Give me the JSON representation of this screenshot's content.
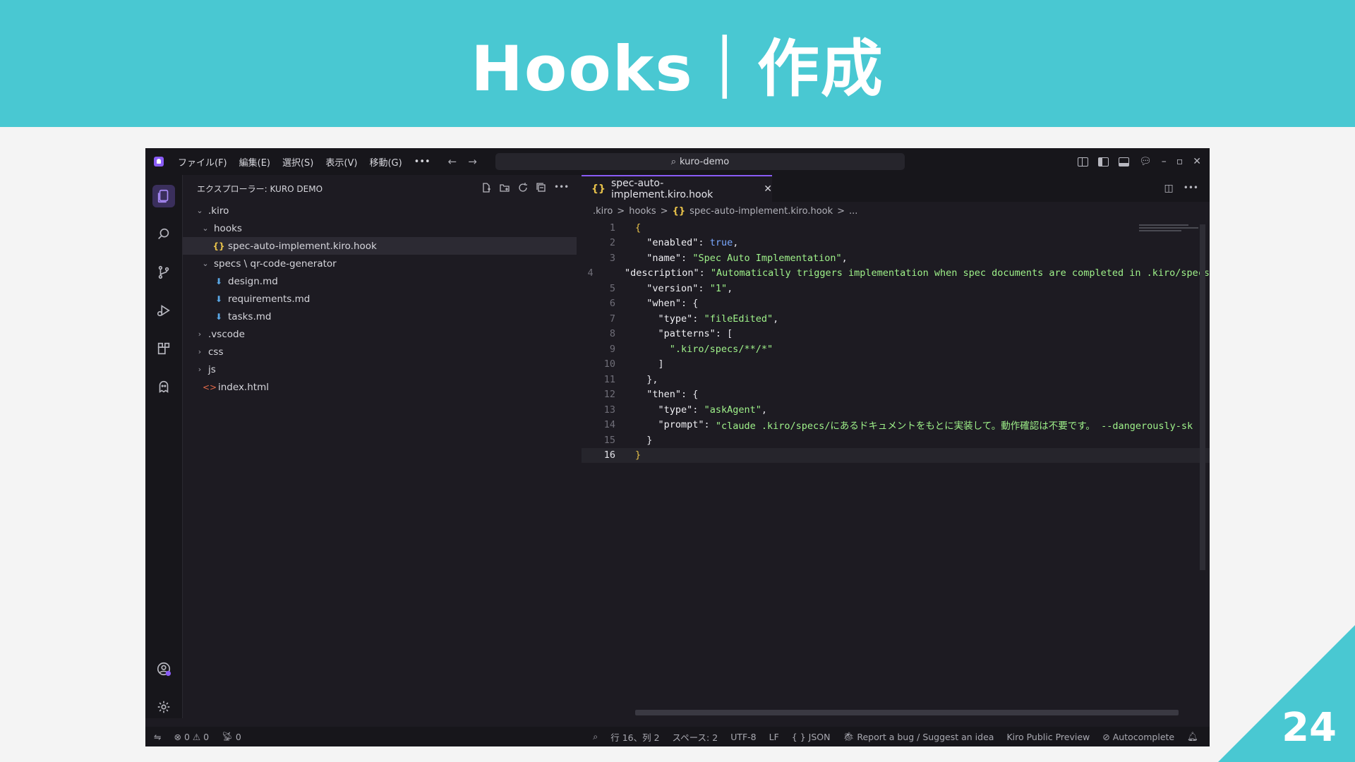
{
  "slide": {
    "title": "Hooks｜作成",
    "page_number": "24"
  },
  "colors": {
    "accent": "#49c8d2",
    "purple": "#8a5cf6"
  },
  "titlebar": {
    "menus": [
      "ファイル(F)",
      "編集(E)",
      "選択(S)",
      "表示(V)",
      "移動(G)"
    ],
    "more": "•••",
    "search": "kuro-demo"
  },
  "sidebar": {
    "header": "エクスプローラー: KURO DEMO",
    "tree": [
      {
        "label": ".kiro",
        "chevron": "⌄",
        "icon": "",
        "indent": 16,
        "selected": false
      },
      {
        "label": "hooks",
        "chevron": "⌄",
        "icon": "",
        "indent": 24,
        "selected": false
      },
      {
        "label": "spec-auto-implement.kiro.hook",
        "chevron": "",
        "icon": "{}",
        "icon_type": "hook",
        "indent": 26,
        "selected": true
      },
      {
        "label": "specs \\ qr-code-generator",
        "chevron": "⌄",
        "icon": "",
        "indent": 24,
        "selected": false
      },
      {
        "label": "design.md",
        "chevron": "",
        "icon": "⬇",
        "icon_type": "md",
        "indent": 26,
        "selected": false
      },
      {
        "label": "requirements.md",
        "chevron": "",
        "icon": "⬇",
        "icon_type": "md",
        "indent": 26,
        "selected": false
      },
      {
        "label": "tasks.md",
        "chevron": "",
        "icon": "⬇",
        "icon_type": "md",
        "indent": 26,
        "selected": false
      },
      {
        "label": ".vscode",
        "chevron": "›",
        "icon": "",
        "indent": 16,
        "selected": false
      },
      {
        "label": "css",
        "chevron": "›",
        "icon": "",
        "indent": 16,
        "selected": false
      },
      {
        "label": "js",
        "chevron": "›",
        "icon": "",
        "indent": 16,
        "selected": false
      },
      {
        "label": "index.html",
        "chevron": "",
        "icon": "<>",
        "icon_type": "html",
        "indent": 12,
        "selected": false
      }
    ]
  },
  "editor": {
    "tab_label": "spec-auto-implement.kiro.hook",
    "tab_icon": "{}",
    "breadcrumbs": [
      ".kiro",
      ">",
      "hooks",
      ">",
      "{}",
      "spec-auto-implement.kiro.hook",
      ">",
      "..."
    ],
    "current_line": 16,
    "lines": [
      [
        [
          "br",
          "{"
        ]
      ],
      [
        [
          "t",
          "  "
        ],
        [
          "k",
          "\"enabled\""
        ],
        [
          "t",
          ": "
        ],
        [
          "b",
          "true"
        ],
        [
          "t",
          ","
        ]
      ],
      [
        [
          "t",
          "  "
        ],
        [
          "k",
          "\"name\""
        ],
        [
          "t",
          ": "
        ],
        [
          "s",
          "\"Spec Auto Implementation\""
        ],
        [
          "t",
          ","
        ]
      ],
      [
        [
          "t",
          "  "
        ],
        [
          "k",
          "\"description\""
        ],
        [
          "t",
          ": "
        ],
        [
          "s",
          "\"Automatically triggers implementation when spec documents are completed in .kiro/specs"
        ]
      ],
      [
        [
          "t",
          "  "
        ],
        [
          "k",
          "\"version\""
        ],
        [
          "t",
          ": "
        ],
        [
          "s",
          "\"1\""
        ],
        [
          "t",
          ","
        ]
      ],
      [
        [
          "t",
          "  "
        ],
        [
          "k",
          "\"when\""
        ],
        [
          "t",
          ": {"
        ]
      ],
      [
        [
          "t",
          "    "
        ],
        [
          "k",
          "\"type\""
        ],
        [
          "t",
          ": "
        ],
        [
          "s",
          "\"fileEdited\""
        ],
        [
          "t",
          ","
        ]
      ],
      [
        [
          "t",
          "    "
        ],
        [
          "k",
          "\"patterns\""
        ],
        [
          "t",
          ": ["
        ]
      ],
      [
        [
          "t",
          "      "
        ],
        [
          "s",
          "\".kiro/specs/**/*\""
        ]
      ],
      [
        [
          "t",
          "    ]"
        ]
      ],
      [
        [
          "t",
          "  },"
        ]
      ],
      [
        [
          "t",
          "  "
        ],
        [
          "k",
          "\"then\""
        ],
        [
          "t",
          ": {"
        ]
      ],
      [
        [
          "t",
          "    "
        ],
        [
          "k",
          "\"type\""
        ],
        [
          "t",
          ": "
        ],
        [
          "s",
          "\"askAgent\""
        ],
        [
          "t",
          ","
        ]
      ],
      [
        [
          "t",
          "    "
        ],
        [
          "k",
          "\"prompt\""
        ],
        [
          "t",
          ": "
        ],
        [
          "s",
          "\"claude .kiro/specs/にあるドキュメントをもとに実装して。動作確認は不要です。 --dangerously-sk"
        ]
      ],
      [
        [
          "t",
          "  }"
        ]
      ],
      [
        [
          "br",
          "}"
        ]
      ]
    ]
  },
  "statusbar": {
    "errors": "0",
    "warnings": "0",
    "ports": "0",
    "position": "行 16、列 2",
    "spaces": "スペース: 2",
    "encoding": "UTF-8",
    "eol": "LF",
    "language": "{ } JSON",
    "report": "Report a bug / Suggest an idea",
    "preview": "Kiro Public Preview",
    "autocomplete": "Autocomplete"
  }
}
